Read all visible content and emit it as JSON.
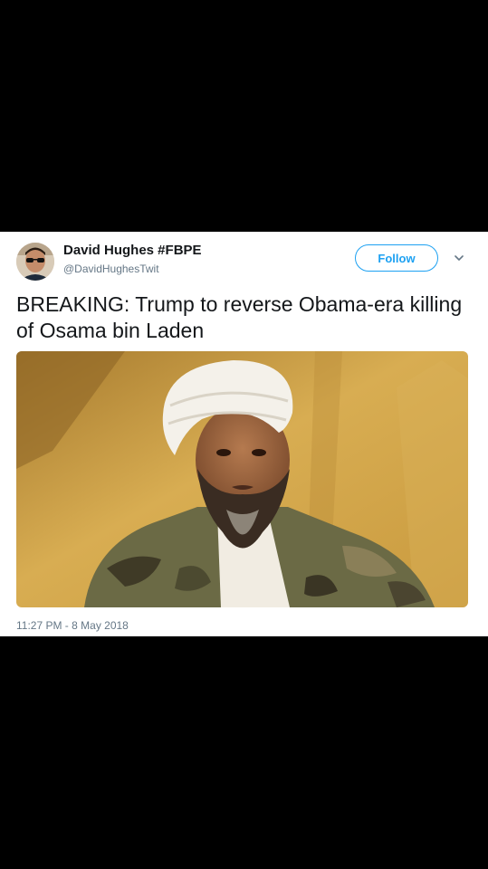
{
  "tweet": {
    "display_name": "David Hughes #FBPE",
    "handle": "@DavidHughesTwit",
    "follow_label": "Follow",
    "text": "BREAKING: Trump to reverse Obama-era killing of Osama bin Laden",
    "timestamp": "11:27 PM - 8 May 2018"
  },
  "icons": {
    "menu": "chevron-down-icon"
  },
  "colors": {
    "accent": "#1da1f2",
    "background": "#000000",
    "card": "#ffffff",
    "secondary_text": "#657786"
  }
}
